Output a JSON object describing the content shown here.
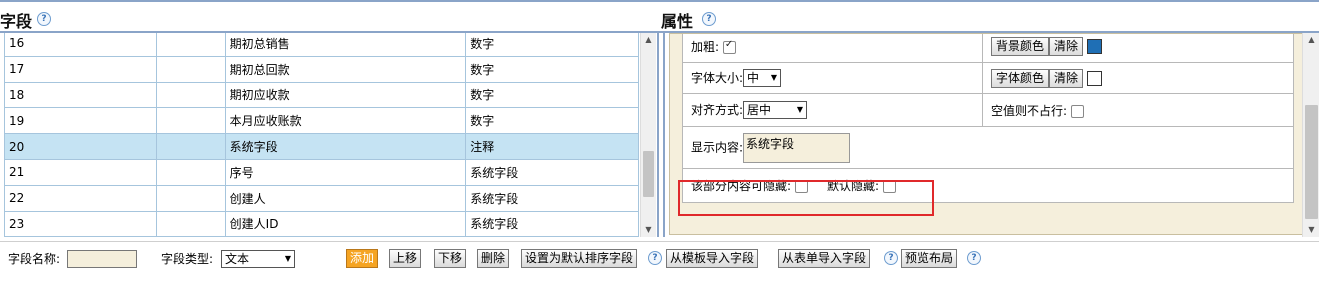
{
  "headers": {
    "left_title": "字段",
    "right_title": "属性",
    "help": "?"
  },
  "rows": [
    {
      "num": "16",
      "name": "期初总销售",
      "type": "数字"
    },
    {
      "num": "17",
      "name": "期初总回款",
      "type": "数字"
    },
    {
      "num": "18",
      "name": "期初应收款",
      "type": "数字"
    },
    {
      "num": "19",
      "name": "本月应收账款",
      "type": "数字"
    },
    {
      "num": "20",
      "name": "系统字段",
      "type": "注释"
    },
    {
      "num": "21",
      "name": "序号",
      "type": "系统字段"
    },
    {
      "num": "22",
      "name": "创建人",
      "type": "系统字段"
    },
    {
      "num": "23",
      "name": "创建人ID",
      "type": "系统字段"
    }
  ],
  "selected_row": "20",
  "props": {
    "bold_label": "加粗:",
    "bold_checked": true,
    "bg_color_button": "背景颜色",
    "clear_button": "清除",
    "bg_swatch_color": "#1f6fb5",
    "font_size_label": "字体大小:",
    "font_size_value": "中",
    "font_color_button": "字体颜色",
    "font_swatch_color": "#ffffff",
    "align_label": "对齐方式:",
    "align_value": "居中",
    "empty_label": "空值则不占行:",
    "display_label": "显示内容:",
    "display_value": "系统字段",
    "hideable_label": "该部分内容可隐藏:",
    "default_hidden_label": "默认隐藏:"
  },
  "bottom": {
    "field_name_label": "字段名称:",
    "field_name_value": "",
    "field_type_label": "字段类型:",
    "field_type_value": "文本",
    "add": "添加",
    "up": "上移",
    "down": "下移",
    "delete": "删除",
    "set_default_sort": "设置为默认排序字段",
    "import_template": "从模板导入字段",
    "import_form": "从表单导入字段",
    "preview_layout": "预览布局"
  }
}
